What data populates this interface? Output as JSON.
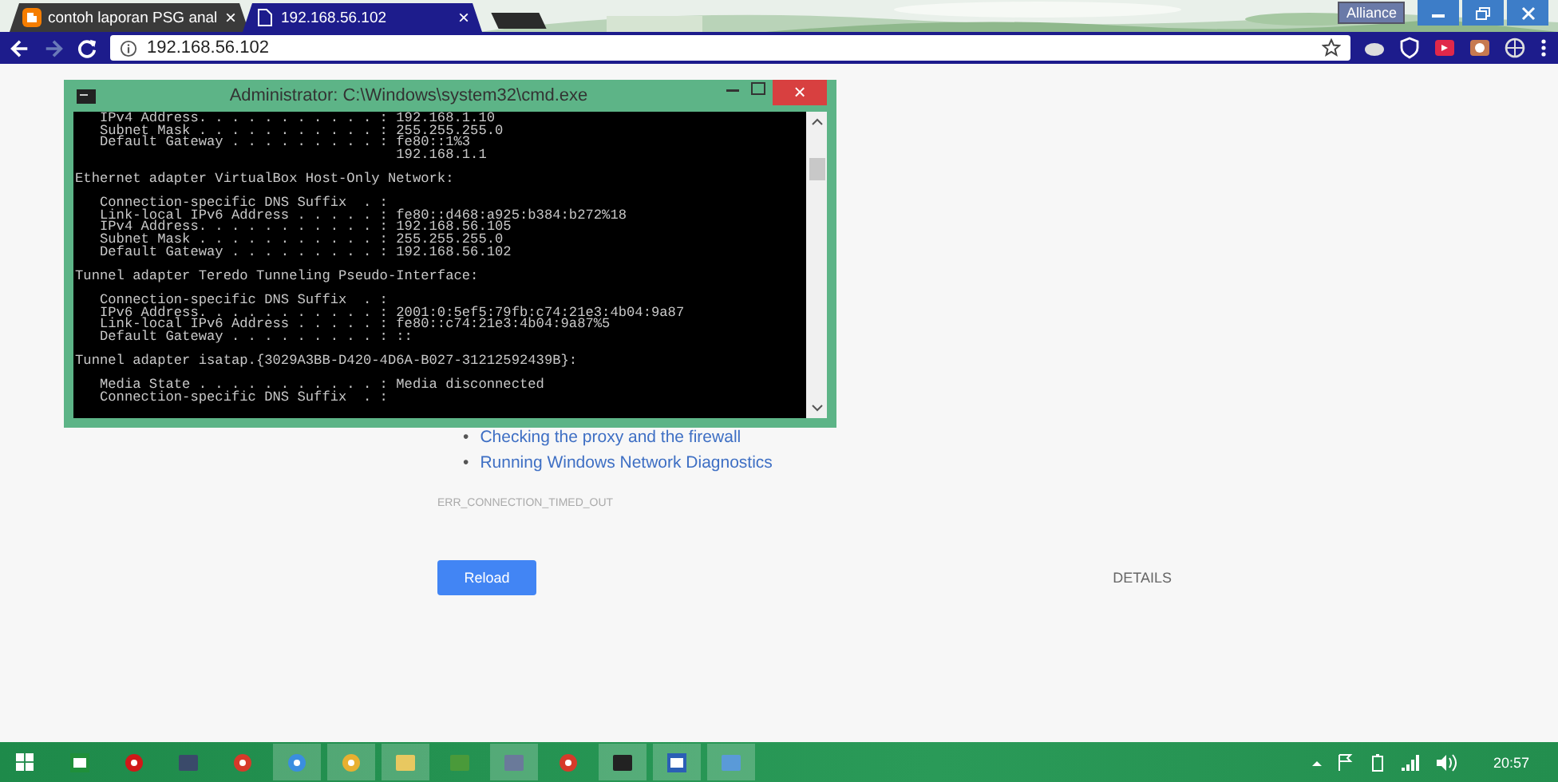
{
  "browser": {
    "tabs": [
      {
        "title": "contoh laporan PSG anal",
        "close": "×",
        "selected": false
      },
      {
        "title": "192.168.56.102",
        "close": "×",
        "selected": true
      }
    ],
    "profile_label": "Alliance",
    "address": {
      "url": "192.168.56.102",
      "forward_disabled": true
    }
  },
  "cmd_window": {
    "title": "Administrator: C:\\Windows\\system32\\cmd.exe",
    "close": "×",
    "blocks": [
      [
        "   IPv4 Address. . . . . . . . . . . : 192.168.1.10",
        "   Subnet Mask . . . . . . . . . . . : 255.255.255.0",
        "   Default Gateway . . . . . . . . . : fe80::1%3",
        "                                       192.168.1.1"
      ],
      [
        "Ethernet adapter VirtualBox Host-Only Network:"
      ],
      [
        "   Connection-specific DNS Suffix  . :",
        "   Link-local IPv6 Address . . . . . : fe80::d468:a925:b384:b272%18",
        "   IPv4 Address. . . . . . . . . . . : 192.168.56.105",
        "   Subnet Mask . . . . . . . . . . . : 255.255.255.0",
        "   Default Gateway . . . . . . . . . : 192.168.56.102"
      ],
      [
        "Tunnel adapter Teredo Tunneling Pseudo-Interface:"
      ],
      [
        "   Connection-specific DNS Suffix  . :",
        "   IPv6 Address. . . . . . . . . . . : 2001:0:5ef5:79fb:c74:21e3:4b04:9a87",
        "   Link-local IPv6 Address . . . . . : fe80::c74:21e3:4b04:9a87%5",
        "   Default Gateway . . . . . . . . . : ::"
      ],
      [
        "Tunnel adapter isatap.{3029A3BB-D420-4D6A-B027-31212592439B}:"
      ],
      [
        "   Media State . . . . . . . . . . . : Media disconnected",
        "   Connection-specific DNS Suffix  . :"
      ]
    ]
  },
  "error_page": {
    "bullet": "•",
    "suggestions": [
      "Checking the proxy and the firewall",
      "Running Windows Network Diagnostics"
    ],
    "error_code": "ERR_CONNECTION_TIMED_OUT",
    "reload_button": "Reload",
    "details_button": "DETAILS"
  },
  "taskbar": {
    "apps": [
      {
        "kind": "excel",
        "active": false
      },
      {
        "kind": "opera",
        "active": false
      },
      {
        "kind": "monitor",
        "active": false
      },
      {
        "kind": "red",
        "active": false
      },
      {
        "kind": "blue",
        "active": true
      },
      {
        "kind": "chrome",
        "active": true
      },
      {
        "kind": "folder",
        "active": true
      },
      {
        "kind": "green",
        "active": false
      },
      {
        "kind": "box",
        "active": true
      },
      {
        "kind": "red",
        "active": false
      },
      {
        "kind": "cmd",
        "active": true
      },
      {
        "kind": "word",
        "active": true
      },
      {
        "kind": "network",
        "active": true
      }
    ],
    "time": "20:57"
  }
}
